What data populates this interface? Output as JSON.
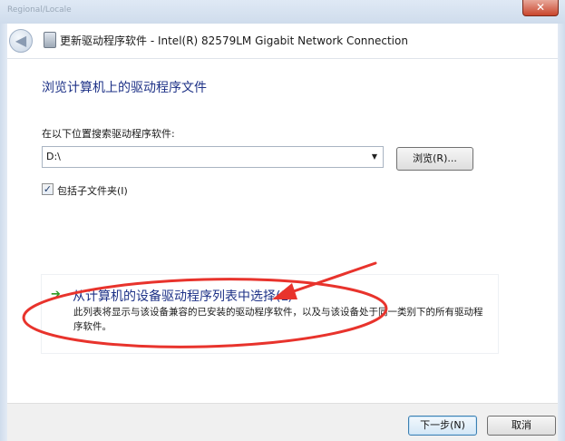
{
  "window": {
    "title": "更新驱动程序软件 - Intel(R) 82579LM Gigabit Network Connection",
    "close_glyph": "✕",
    "back_glyph": "◀",
    "background_ghost_text": "Regional/Locale"
  },
  "page": {
    "title": "浏览计算机上的驱动程序文件",
    "search_label": "在以下位置搜索驱动程序软件:"
  },
  "path_combo": {
    "value": "D:\\",
    "arrow_glyph": "▼"
  },
  "browse_button": {
    "label": "浏览(R)..."
  },
  "include_subfolders": {
    "checked": true,
    "check_glyph": "✓",
    "label": "包括子文件夹(I)"
  },
  "pick_from_list": {
    "arrow_glyph": "➔",
    "title": "从计算机的设备驱动程序列表中选择(L)",
    "description": "此列表将显示与该设备兼容的已安装的驱动程序软件，以及与该设备处于同一类别下的所有驱动程序软件。"
  },
  "footer": {
    "next_label": "下一步(N)",
    "cancel_label": "取消"
  },
  "colors": {
    "heading_blue": "#1e3287",
    "annotation_red": "#e8332c",
    "green_arrow": "#2f9a24"
  }
}
